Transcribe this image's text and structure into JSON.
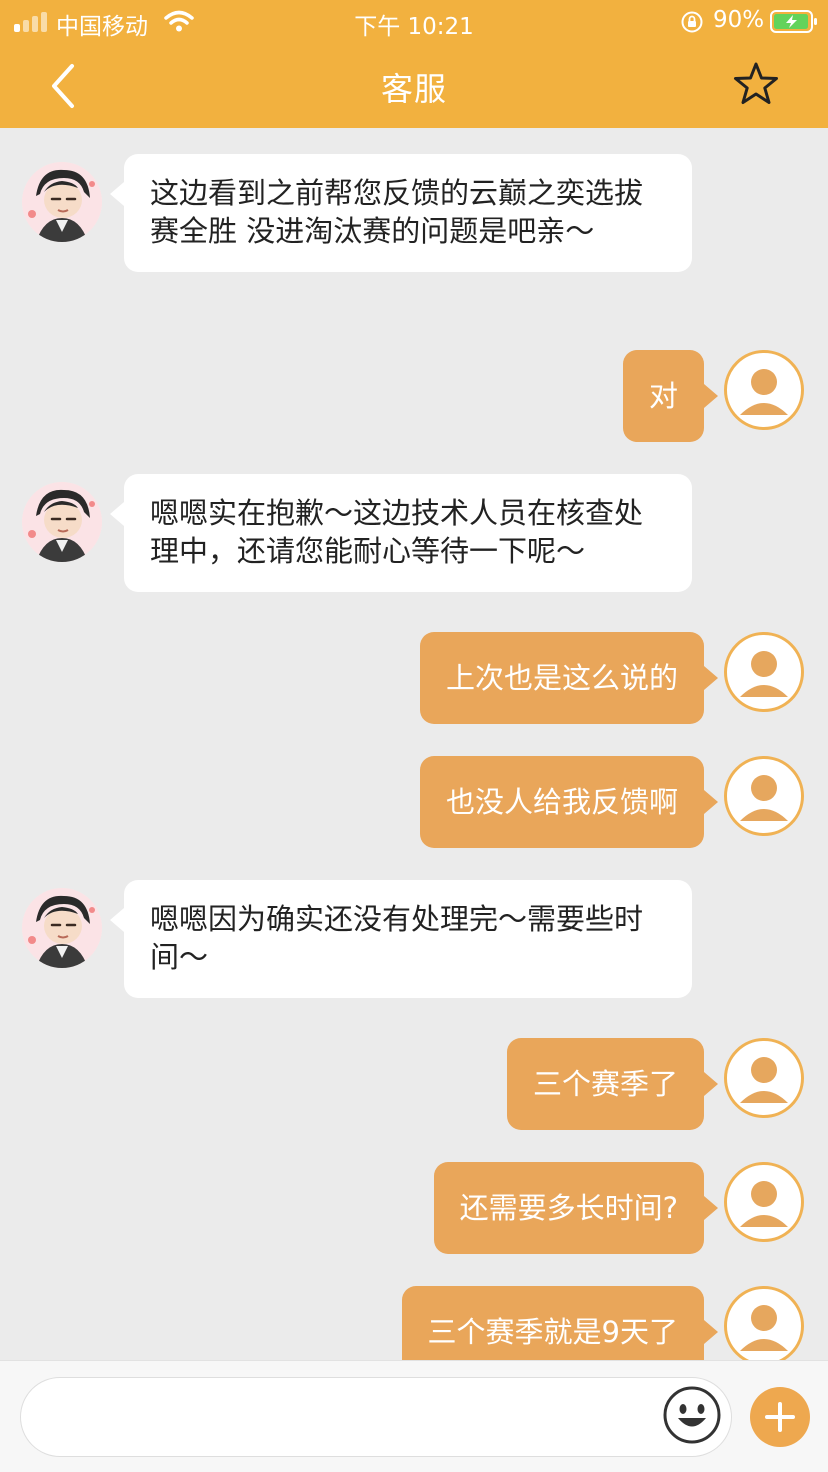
{
  "status_bar": {
    "carrier": "中国移动",
    "time": "下午 10:21",
    "battery": "90%"
  },
  "nav": {
    "title": "客服",
    "back_icon": "chevron-left-icon",
    "favorite_icon": "star-outline-icon"
  },
  "colors": {
    "header": "#f2b13f",
    "user_bubble": "#e9a65a",
    "agent_bubble": "#ffffff",
    "background": "#ebebeb"
  },
  "messages": [
    {
      "sender": "agent",
      "text": "这边看到之前帮您反馈的云巅之奕选拔赛全胜 没进淘汰赛的问题是吧亲～"
    },
    {
      "sender": "user",
      "text": "对"
    },
    {
      "sender": "agent",
      "text": "嗯嗯实在抱歉～这边技术人员在核查处理中，还请您能耐心等待一下呢～"
    },
    {
      "sender": "user",
      "text": "上次也是这么说的"
    },
    {
      "sender": "user",
      "text": "也没人给我反馈啊"
    },
    {
      "sender": "agent",
      "text": "嗯嗯因为确实还没有处理完～需要些时间～"
    },
    {
      "sender": "user",
      "text": "三个赛季了"
    },
    {
      "sender": "user",
      "text": "还需要多长时间?"
    },
    {
      "sender": "user",
      "text": "三个赛季就是9天了"
    }
  ],
  "input": {
    "value": "",
    "emoji_icon": "emoji-icon",
    "add_icon": "plus-icon"
  }
}
